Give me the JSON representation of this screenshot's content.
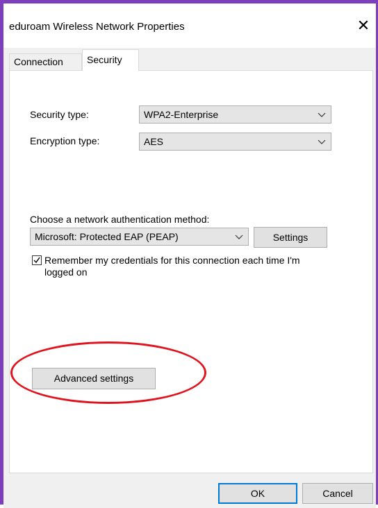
{
  "window": {
    "title": "eduroam Wireless Network Properties",
    "close_glyph": "✕"
  },
  "tabs": [
    {
      "label": "Connection",
      "selected": false
    },
    {
      "label": "Security",
      "selected": true
    }
  ],
  "security": {
    "security_type_label": "Security type:",
    "security_type_value": "WPA2-Enterprise",
    "encryption_type_label": "Encryption type:",
    "encryption_type_value": "AES",
    "auth_method_label": "Choose a network authentication method:",
    "auth_method_value": "Microsoft: Protected EAP (PEAP)",
    "settings_button": "Settings",
    "remember_credentials_label": "Remember my credentials for this connection each time I'm logged on",
    "remember_credentials_checked": true,
    "advanced_settings_button": "Advanced settings"
  },
  "footer": {
    "ok_button": "OK",
    "cancel_button": "Cancel"
  },
  "colors": {
    "window_border": "#7d3fbd",
    "highlight_oval": "#e0141f",
    "default_button_border": "#0078d7"
  },
  "icons": [
    "close-icon",
    "chevron-down-icon",
    "checkmark-icon"
  ]
}
